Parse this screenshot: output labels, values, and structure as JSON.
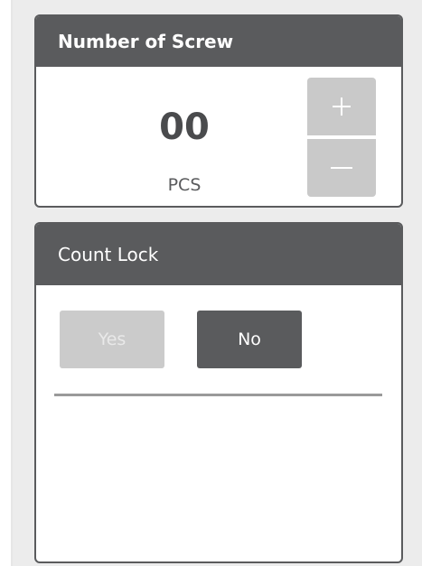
{
  "screw_count": {
    "title": "Number of Screw",
    "value": "00",
    "unit": "PCS",
    "increment_icon": "plus-icon",
    "decrement_icon": "minus-icon"
  },
  "count_lock": {
    "title": "Count Lock",
    "yes_label": "Yes",
    "no_label": "No",
    "selected": "No"
  },
  "colors": {
    "header": "#5a5b5d",
    "stepper": "#c9c9c9",
    "inactive_button": "#cbcbcb",
    "active_button": "#5a5b5d",
    "background": "#ececec"
  }
}
